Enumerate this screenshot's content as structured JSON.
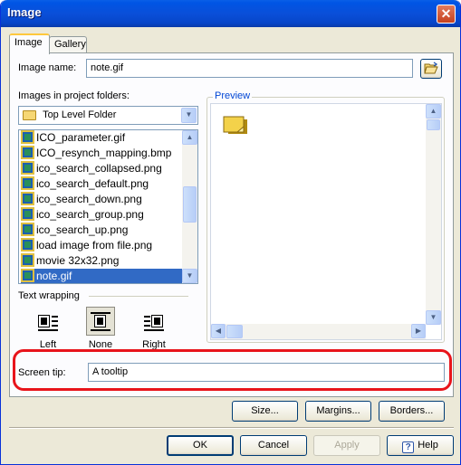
{
  "window": {
    "title": "Image",
    "close_glyph": "✕"
  },
  "tabs": [
    {
      "label": "Image",
      "active": true
    },
    {
      "label": "Gallery",
      "active": false
    }
  ],
  "image_name": {
    "label": "Image name:",
    "value": "note.gif",
    "browse_icon": "open-folder-icon"
  },
  "project_folders": {
    "label": "Images in project folders:",
    "folder_combo": {
      "value": "Top Level Folder",
      "icon": "folder-icon"
    },
    "files": [
      {
        "name": "ICO_parameter.gif",
        "selected": false
      },
      {
        "name": "ICO_resynch_mapping.bmp",
        "selected": false
      },
      {
        "name": "ico_search_collapsed.png",
        "selected": false
      },
      {
        "name": "ico_search_default.png",
        "selected": false
      },
      {
        "name": "ico_search_down.png",
        "selected": false
      },
      {
        "name": "ico_search_group.png",
        "selected": false
      },
      {
        "name": "ico_search_up.png",
        "selected": false
      },
      {
        "name": "load image from file.png",
        "selected": false
      },
      {
        "name": "movie 32x32.png",
        "selected": false
      },
      {
        "name": "note.gif",
        "selected": true
      }
    ]
  },
  "preview": {
    "label": "Preview",
    "icon": "sticky-note-icon"
  },
  "text_wrapping": {
    "label": "Text wrapping",
    "options": [
      {
        "label": "Left",
        "selected": false
      },
      {
        "label": "None",
        "selected": true
      },
      {
        "label": "Right",
        "selected": false
      }
    ]
  },
  "screen_tip": {
    "label": "Screen tip:",
    "value": "A tooltip"
  },
  "buttons": {
    "size": "Size...",
    "margins": "Margins...",
    "borders": "Borders...",
    "ok": "OK",
    "cancel": "Cancel",
    "apply": "Apply",
    "help": "Help"
  },
  "colors": {
    "highlight": "#e8141b",
    "selection": "#316ac5",
    "titlebar": "#0a4fd9"
  }
}
